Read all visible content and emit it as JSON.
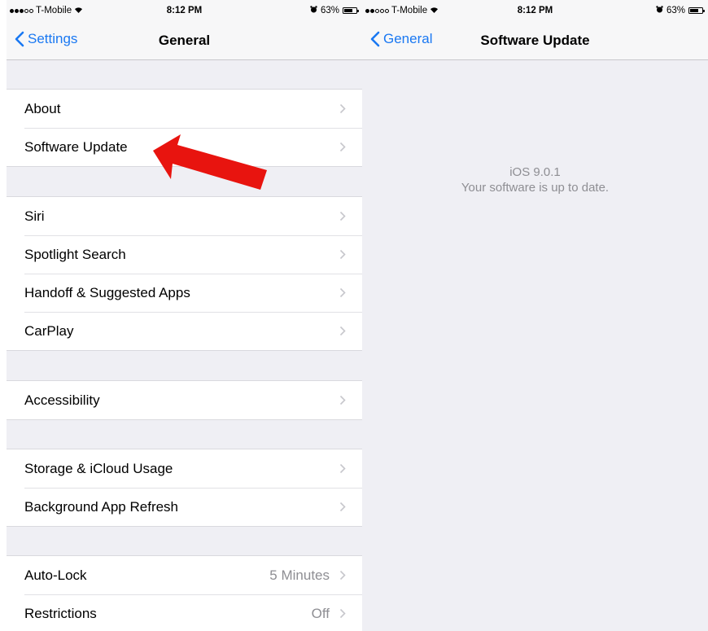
{
  "left_screen": {
    "status": {
      "carrier": "T-Mobile",
      "time": "8:12 PM",
      "battery": "63%",
      "battery_level": 0.63,
      "signal_bars": 3
    },
    "nav": {
      "back_label": "Settings",
      "title": "General"
    },
    "groups": [
      {
        "items": [
          {
            "label": "About"
          },
          {
            "label": "Software Update"
          }
        ]
      },
      {
        "items": [
          {
            "label": "Siri"
          },
          {
            "label": "Spotlight Search"
          },
          {
            "label": "Handoff & Suggested Apps"
          },
          {
            "label": "CarPlay"
          }
        ]
      },
      {
        "items": [
          {
            "label": "Accessibility"
          }
        ]
      },
      {
        "items": [
          {
            "label": "Storage & iCloud Usage"
          },
          {
            "label": "Background App Refresh"
          }
        ]
      },
      {
        "items": [
          {
            "label": "Auto-Lock",
            "value": "5 Minutes"
          },
          {
            "label": "Restrictions",
            "value": "Off"
          }
        ]
      }
    ]
  },
  "right_screen": {
    "status": {
      "carrier": "T-Mobile",
      "time": "8:12 PM",
      "battery": "63%",
      "battery_level": 0.63,
      "signal_bars": 2
    },
    "nav": {
      "back_label": "General",
      "title": "Software Update"
    },
    "version": "iOS 9.0.1",
    "status_message": "Your software is up to date."
  },
  "colors": {
    "accent": "#1a78f2",
    "background": "#efeff4",
    "arrow": "#e8140f",
    "secondary_text": "#8e8e93"
  }
}
